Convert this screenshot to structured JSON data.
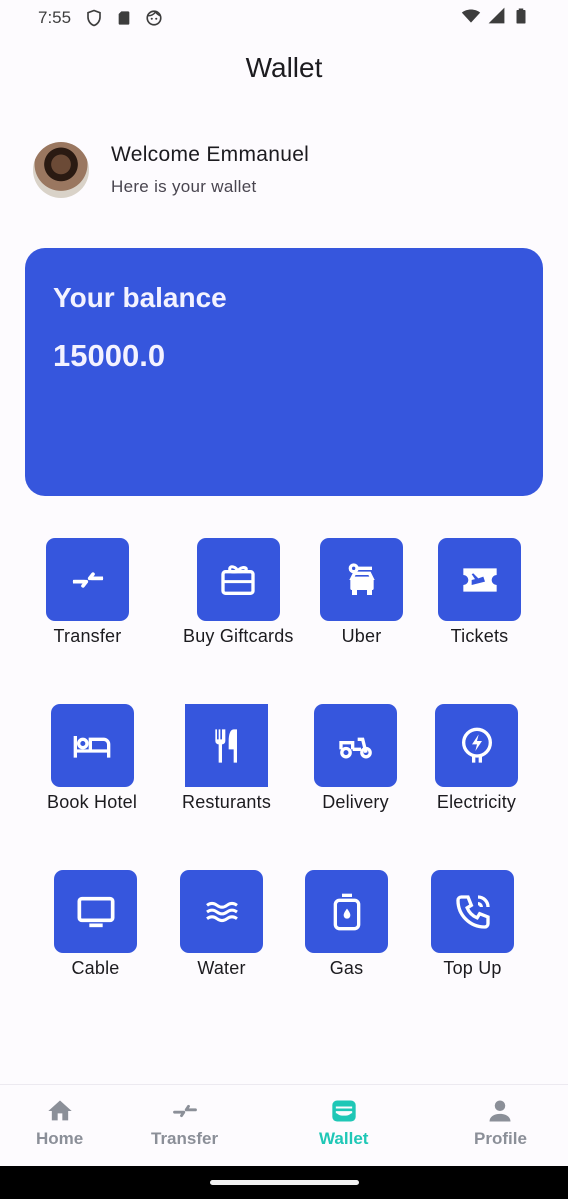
{
  "status_bar": {
    "time": "7:55",
    "left_icons": [
      "shield-icon",
      "sd-card-icon",
      "face-icon"
    ],
    "right_icons": [
      "wifi-icon",
      "signal-icon",
      "battery-icon"
    ]
  },
  "header": {
    "title": "Wallet"
  },
  "welcome": {
    "greeting": "Welcome Emmanuel",
    "subtitle": "Here is your wallet"
  },
  "balance": {
    "label": "Your balance",
    "amount": "15000.0",
    "card_color": "#3656dd"
  },
  "services": {
    "row1": [
      {
        "label": "Transfer",
        "icon": "transfer-arrows-icon"
      },
      {
        "label": "Buy Giftcards",
        "icon": "giftcard-icon"
      },
      {
        "label": "Uber",
        "icon": "taxi-icon"
      },
      {
        "label": "Tickets",
        "icon": "flight-ticket-icon"
      }
    ],
    "row2": [
      {
        "label": "Book Hotel",
        "icon": "hotel-bed-icon"
      },
      {
        "label": "Resturants",
        "icon": "restaurant-icon"
      },
      {
        "label": "Delivery",
        "icon": "scooter-icon"
      },
      {
        "label": "Electricity",
        "icon": "electricity-icon"
      }
    ],
    "row3": [
      {
        "label": "Cable",
        "icon": "tv-icon"
      },
      {
        "label": "Water",
        "icon": "water-waves-icon"
      },
      {
        "label": "Gas",
        "icon": "gas-cylinder-icon"
      },
      {
        "label": "Top Up",
        "icon": "phone-call-icon"
      }
    ]
  },
  "bottom_nav": {
    "items": [
      {
        "label": "Home",
        "icon": "home-icon",
        "active": false
      },
      {
        "label": "Transfer",
        "icon": "transfer-arrows-icon",
        "active": false
      },
      {
        "label": "Wallet",
        "icon": "wallet-icon",
        "active": true
      },
      {
        "label": "Profile",
        "icon": "person-icon",
        "active": false
      }
    ],
    "active_color": "#1fc7b6",
    "inactive_color": "#8b8f98"
  }
}
